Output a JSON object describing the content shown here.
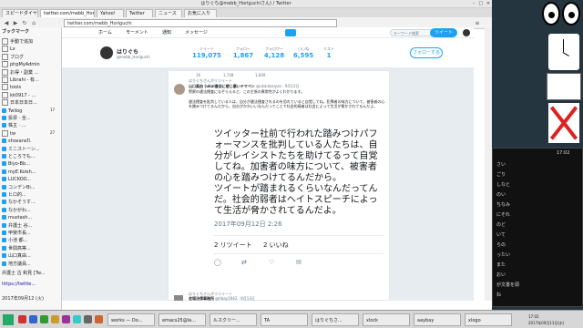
{
  "window": {
    "title": "はりぐち@mebb_Horiguchiさん) / Twitter"
  },
  "tabs": [
    {
      "label": "スピードダイヤル"
    },
    {
      "label": "twitter.com/mebb_Horiguchi"
    },
    {
      "label": "Yahoo!"
    },
    {
      "label": "Twitter"
    },
    {
      "label": "ニュース"
    },
    {
      "label": "お気に入り"
    }
  ],
  "address": {
    "url": "twitter.com/mebb_Horiguchi"
  },
  "bookmarks_label": "ブックマーク",
  "sidebar": {
    "items": [
      {
        "label": "手動で追加"
      },
      {
        "label": "Lx"
      },
      {
        "label": "ブログ"
      },
      {
        "label": "phpMyAdmin"
      },
      {
        "label": "お得・副業 ..."
      },
      {
        "label": "Librahi - 有..."
      },
      {
        "label": "tools"
      },
      {
        "label": "kk0917 - ..."
      },
      {
        "label": "日本日本日..."
      },
      {
        "label": "Twilog"
      },
      {
        "label": "投票 · 全..."
      },
      {
        "label": "株主 · ..."
      },
      {
        "label": "tw"
      },
      {
        "label": "shoxaraれ"
      },
      {
        "label": "ミニストーン..."
      },
      {
        "label": "ところでも..."
      },
      {
        "label": "Biyo-Bb..."
      },
      {
        "label": "myE.Koish..."
      },
      {
        "label": "LUCKOO..."
      },
      {
        "label": "コンデンBi..."
      },
      {
        "label": "ヒロ的..."
      },
      {
        "label": "なかそうす..."
      },
      {
        "label": "なかがわ..."
      },
      {
        "label": "mustash..."
      },
      {
        "label": "弁護士 谷..."
      },
      {
        "label": "甲斐市長..."
      },
      {
        "label": "小池 都..."
      },
      {
        "label": "世間高等..."
      },
      {
        "label": "山口真由..."
      },
      {
        "label": "地方議員..."
      }
    ],
    "counts": [
      "17",
      "27"
    ],
    "footer_text": "弁護士 古 和見 [Tw...",
    "footer_link": "https://twitte...",
    "footer_date": "2017年09月12 (火)"
  },
  "twnav": {
    "home": "ホーム",
    "moments": "モーメント",
    "notifications": "通知",
    "messages": "メッセージ",
    "search_placeholder": "キーワード検索",
    "tweet_button": "ツイート"
  },
  "profile": {
    "name": "はりぐち",
    "handle": "@mebb_Horiguchi",
    "stats": [
      {
        "label": "ツイート",
        "value": "119,075"
      },
      {
        "label": "フォロー",
        "value": "1,867"
      },
      {
        "label": "フォロワー",
        "value": "4,128"
      },
      {
        "label": "いいね",
        "value": "6,595"
      },
      {
        "label": "リスト",
        "value": "1"
      }
    ],
    "follow_button": "フォローする"
  },
  "tweet": {
    "actions_top": {
      "reply": "16",
      "retweet": "1,728",
      "like": "1,609"
    },
    "retweet_note": "はりぐちさんがリツイート",
    "quote_author": "山口真由 (ukai書店に感じ悪いヤマペン",
    "quote_handle": "@ukaiakaiyan · 9月12日",
    "quote_line1": "警察の違法捜査になぞらえると、この主張の異常性がよくわかります。",
    "quote_line2": "違法捜査を批判している人は、自分が違法捜査されるのを恐れていると自覚してね。犯罪者の味方について、被害者の心を踏みつけてるんだから、自分がかわいいなんだってことで社会的弱者は社会によって生活が脅かされてるんだよ。",
    "body": "ツイッター社前で行われた踏みつけパフォーマンスを批判している人たちは、自分がレイシストたちを助けてるって自覚してね。加害者の味方について、被害者の心を踏みつけてるんだから。\nツイートが踏まれるくらいなんだってんだ。社会的弱者はヘイトスピーチによって生活が脅かされてるんだよ。",
    "date": "2017年09月12日 2:26",
    "retweets": "2 リツイート",
    "likes": "2 いいね",
    "next_note": "はりぐちさんがリツイート",
    "next_author": "会場法律事務所",
    "next_handle": "@hbay1942 · 9月13日"
  },
  "desktop": {
    "terminal_time": "17:02",
    "terminal_lines": [
      "さい",
      "ごり",
      "しなと",
      "のい",
      "ちなみ",
      "にそれ",
      "のど",
      "いて",
      "らの",
      "ったい",
      "また",
      "おい",
      "が文書を頭",
      "ね"
    ]
  },
  "taskbar": {
    "tasks": [
      {
        "label": "works — Do..."
      },
      {
        "label": "emacs25@la..."
      },
      {
        "label": "ルスクリー..."
      },
      {
        "label": "TA"
      },
      {
        "label": "はりぐちさ..."
      },
      {
        "label": "xlock"
      },
      {
        "label": "aaybay"
      },
      {
        "label": "xlogo"
      }
    ],
    "clock": "17:02",
    "date": "2017年09月13日(水)"
  },
  "colors": {
    "accent": "#1da1f2",
    "timeline_bg": "#e6ecf0"
  }
}
